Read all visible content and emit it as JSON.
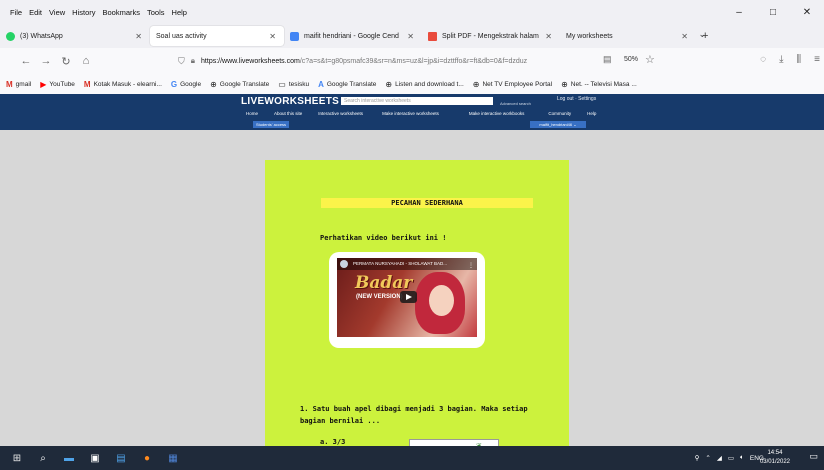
{
  "browser": {
    "menu": [
      "File",
      "Edit",
      "View",
      "History",
      "Bookmarks",
      "Tools",
      "Help"
    ],
    "window_controls": {
      "minimize": "–",
      "maximize": "□",
      "close": "✕"
    },
    "tabs": [
      {
        "label": "(3) WhatsApp",
        "icon": "whatsapp-icon",
        "icon_color": "#25d366",
        "active": false
      },
      {
        "label": "Soal uas activity",
        "icon": "",
        "icon_color": "",
        "active": true
      },
      {
        "label": "maifit hendriani - Google Cend",
        "icon": "google-icon",
        "icon_color": "#4285f4",
        "active": false
      },
      {
        "label": "Split PDF - Mengekstrak halam",
        "icon": "pdf-icon",
        "icon_color": "#e94b3c",
        "active": false
      },
      {
        "label": "My worksheets",
        "icon": "",
        "icon_color": "",
        "active": false
      }
    ],
    "new_tab": "+",
    "tab_list": "⌄",
    "url_host": "https://www.liveworksheets.com",
    "url_path": "/c?a=s&t=g80psmafc39&sr=n&ms=uz&l=jp&i=dzttffo&r=ft&db=0&f=dzduz",
    "zoom": "50%",
    "bookmarks": [
      {
        "label": "gmail",
        "icon": "gmail-icon",
        "glyph": "M",
        "color": "#d93025"
      },
      {
        "label": "YouTube",
        "icon": "youtube-icon",
        "glyph": "▶",
        "color": "#ff0000"
      },
      {
        "label": "Kotak Masuk - elearni...",
        "icon": "gmail-icon",
        "glyph": "M",
        "color": "#d93025"
      },
      {
        "label": "Google",
        "icon": "google-icon",
        "glyph": "G",
        "color": "#4285f4"
      },
      {
        "label": "Google Translate",
        "icon": "globe-icon",
        "glyph": "⊕",
        "color": "#555555"
      },
      {
        "label": "tesisku",
        "icon": "folder-icon",
        "glyph": "▭",
        "color": "#555555"
      },
      {
        "label": "Google Translate",
        "icon": "translate-icon",
        "glyph": "A",
        "color": "#4285f4"
      },
      {
        "label": "Listen and download t...",
        "icon": "globe-icon",
        "glyph": "⊕",
        "color": "#555555"
      },
      {
        "label": "Net TV Employee Portal",
        "icon": "globe-icon",
        "glyph": "⊕",
        "color": "#555555"
      },
      {
        "label": "Net. -- Televisi Masa ...",
        "icon": "globe-icon",
        "glyph": "⊕",
        "color": "#555555"
      }
    ]
  },
  "site": {
    "logo": "LIVEWORKSHEETS",
    "search_placeholder": "Search interactive worksheets",
    "advanced_search": "Advanced search",
    "login_links": "Log out · Settings",
    "nav": [
      "Home",
      "About this site",
      "Interactive worksheets",
      "Make interactive worksheets",
      "Make interactive workbooks",
      "Community",
      "Help"
    ],
    "share_button": "Students' access",
    "user_menu": "maifit_hendriani46 ⌄"
  },
  "worksheet": {
    "title": "PECAHAN SEDERHANA",
    "instruction": "Perhatikan video berikut ini !",
    "video": {
      "channel_title": "PERMATA NURSYAHADI - SHOLAWAT BAD...",
      "big_text": "Badar",
      "sub_text": "(NEW VERSION)"
    },
    "question": "1. Satu buah apel dibagi menjadi 3 bagian. Maka setiap bagian bernilai ...",
    "option_a": "a. 3/3"
  },
  "taskbar": {
    "tray": [
      "ENG"
    ],
    "time": "14:54",
    "date": "03/01/2022"
  }
}
